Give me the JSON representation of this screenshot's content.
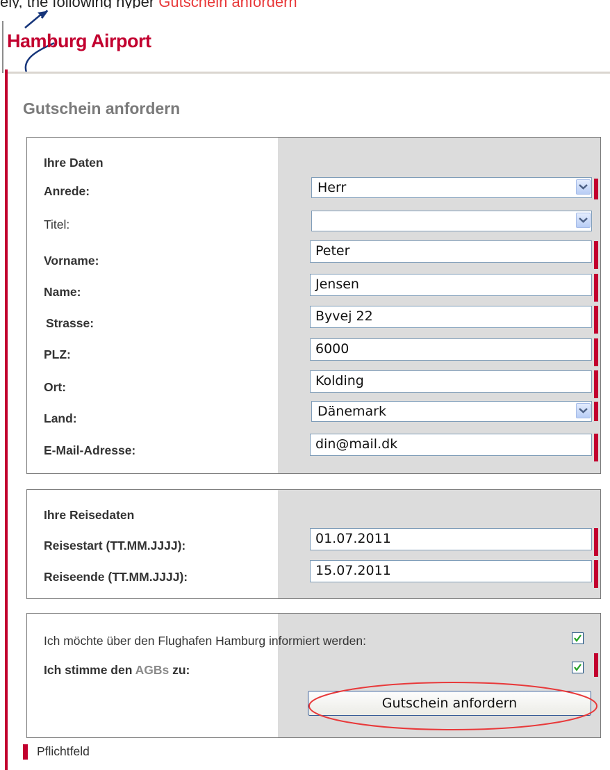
{
  "top_caption": {
    "prefix": "ely, the following hyper ",
    "highlight": "Gutschein anfordern"
  },
  "logo": {
    "text": "Hamburg Airport"
  },
  "page_title": "Gutschein anfordern",
  "section_personal": {
    "heading": "Ihre Daten",
    "fields": {
      "anrede": {
        "label": "Anrede:",
        "value": "Herr",
        "required": true
      },
      "titel": {
        "label": "Titel:",
        "value": "",
        "required": false
      },
      "vorname": {
        "label": "Vorname:",
        "value": "Peter",
        "required": true
      },
      "name": {
        "label": "Name:",
        "value": "Jensen",
        "required": true
      },
      "strasse": {
        "label": "Strasse:",
        "value": "Byvej 22",
        "required": true
      },
      "plz": {
        "label": "PLZ:",
        "value": "6000",
        "required": true
      },
      "ort": {
        "label": "Ort:",
        "value": "Kolding",
        "required": true
      },
      "land": {
        "label": "Land:",
        "value": "Dänemark",
        "required": true
      },
      "email": {
        "label": "E-Mail-Adresse:",
        "value": "din@mail.dk",
        "required": true
      }
    }
  },
  "section_travel": {
    "heading": "Ihre Reisedaten",
    "fields": {
      "reisestart": {
        "label": "Reisestart (TT.MM.JJJJ):",
        "value": "01.07.2011",
        "required": true
      },
      "reiseende": {
        "label": "Reiseende (TT.MM.JJJJ):",
        "value": "15.07.2011",
        "required": true
      }
    }
  },
  "section_consent": {
    "newsletter": {
      "label": "Ich möchte über den Flughafen Hamburg informiert werden:",
      "checked": true
    },
    "agb": {
      "label_prefix": "Ich stimme den ",
      "link": "AGBs",
      "label_suffix": " zu:",
      "checked": true,
      "required": true
    },
    "submit_label": "Gutschein anfordern"
  },
  "legend": {
    "text": "Pflichtfeld"
  },
  "colors": {
    "brand_red": "#c2002f",
    "section_gray": "#dcdcdc",
    "annotation_red": "#e8393a"
  }
}
